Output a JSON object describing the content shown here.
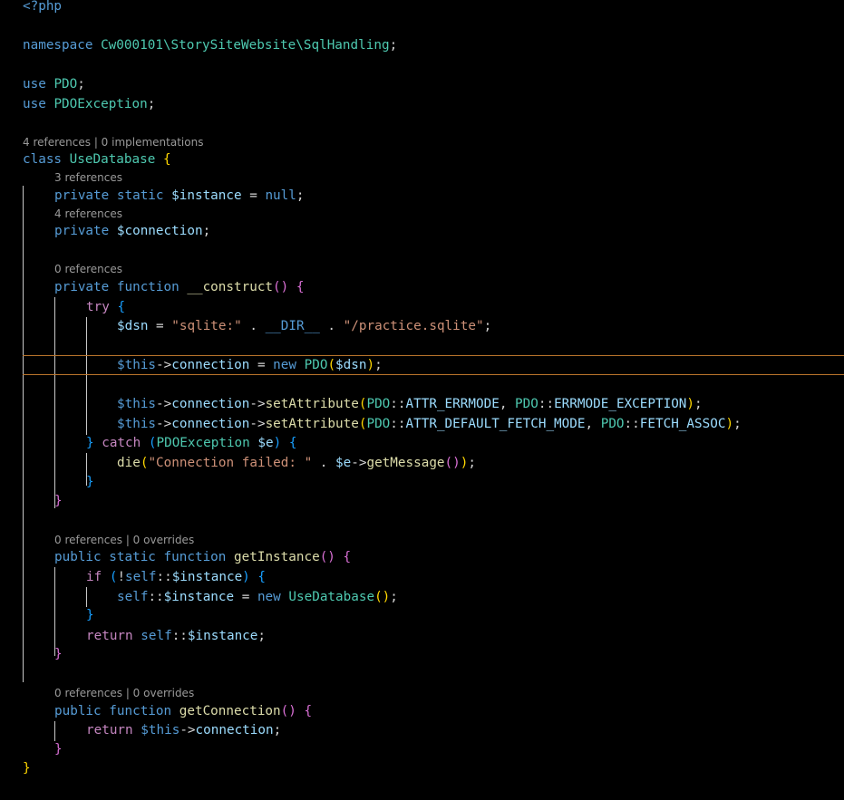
{
  "colors": {
    "background": "#000000",
    "keyword": "#569cd6",
    "control_keyword": "#c586c0",
    "class_name": "#4ec9b0",
    "variable": "#9cdcfe",
    "function": "#dcdcaa",
    "string": "#ce9178",
    "bracket_level_1": "#ffd700",
    "bracket_level_2": "#da70d6",
    "bracket_level_3": "#179fff",
    "codelens": "#9a9a9a",
    "current_line_border": "#b9742b"
  },
  "code": {
    "php_open": "<?php",
    "ns_keyword": "namespace",
    "ns_name": "Cw000101\\StorySiteWebsite\\SqlHandling",
    "use_keyword": "use",
    "use_pdo": "PDO",
    "use_pdo_exception": "PDOException",
    "class_keyword": "class",
    "class_name": "UseDatabase",
    "private_kw": "private",
    "static_kw": "static",
    "public_kw": "public",
    "function_kw": "function",
    "new_kw": "new",
    "return_kw": "return",
    "try_kw": "try",
    "catch_kw": "catch",
    "if_kw": "if",
    "self_kw": "self",
    "null_kw": "null",
    "instance_var": "$instance",
    "connection_var": "$connection",
    "connection_prop": "connection",
    "this_var": "$this",
    "dsn_var": "$dsn",
    "e_var": "$e",
    "instance_prop": "$instance",
    "construct_fn": "__construct",
    "get_instance_fn": "getInstance",
    "get_connection_fn": "getConnection",
    "set_attribute_fn": "setAttribute",
    "die_fn": "die",
    "get_message_fn": "getMessage",
    "dir_const": "__DIR__",
    "str_sqlite": "\"sqlite:\"",
    "str_path": "\"/practice.sqlite\"",
    "str_conn_failed": "\"Connection failed: \"",
    "attr_errmode": "ATTR_ERRMODE",
    "errmode_exception": "ERRMODE_EXCEPTION",
    "attr_default_fetch_mode": "ATTR_DEFAULT_FETCH_MODE",
    "fetch_assoc": "FETCH_ASSOC"
  },
  "codelens": {
    "class_refs": "4 references | 0 implementations",
    "instance_refs": "3 references",
    "connection_refs": "4 references",
    "construct_refs": "0 references",
    "get_instance_refs": "0 references | 0 overrides",
    "get_connection_refs": "0 references | 0 overrides"
  }
}
